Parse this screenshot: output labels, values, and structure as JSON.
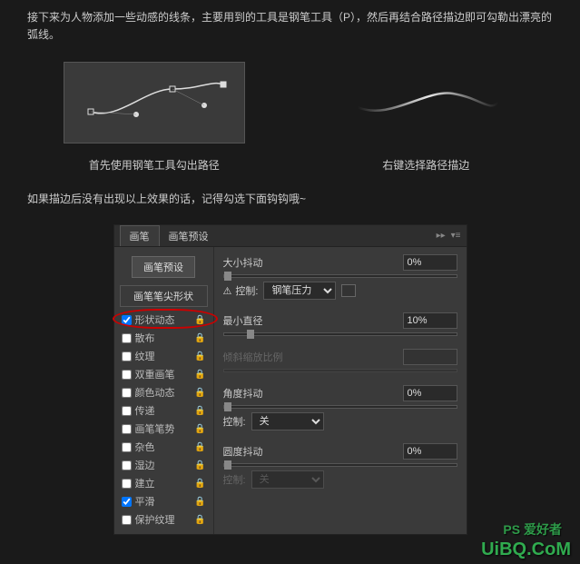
{
  "intro": "接下来为人物添加一些动感的线条，主要用到的工具是钢笔工具（P），然后再结合路径描边即可勾勒出漂亮的弧线。",
  "demo1_caption": "首先使用钢笔工具勾出路径",
  "demo2_caption": "右键选择路径描边",
  "note": "如果描边后没有出现以上效果的话，记得勾选下面钩钩哦~",
  "panel": {
    "tab_brush": "画笔",
    "tab_preset": "画笔预设",
    "preset_btn": "画笔预设",
    "tip_btn": "画笔笔尖形状",
    "options": [
      {
        "label": "形状动态",
        "checked": true,
        "locked": true,
        "highlight": true
      },
      {
        "label": "散布",
        "checked": false,
        "locked": true
      },
      {
        "label": "纹理",
        "checked": false,
        "locked": true
      },
      {
        "label": "双重画笔",
        "checked": false,
        "locked": true
      },
      {
        "label": "颜色动态",
        "checked": false,
        "locked": true
      },
      {
        "label": "传递",
        "checked": false,
        "locked": true
      },
      {
        "label": "画笔笔势",
        "checked": false,
        "locked": true
      },
      {
        "label": "杂色",
        "checked": false,
        "locked": true
      },
      {
        "label": "湿边",
        "checked": false,
        "locked": true
      },
      {
        "label": "建立",
        "checked": false,
        "locked": true
      },
      {
        "label": "平滑",
        "checked": true,
        "locked": true
      },
      {
        "label": "保护纹理",
        "checked": false,
        "locked": true
      }
    ],
    "controls": {
      "size_jitter_label": "大小抖动",
      "size_jitter_value": "0%",
      "control_label": "控制:",
      "control_value": "钢笔压力",
      "min_diameter_label": "最小直径",
      "min_diameter_value": "10%",
      "tilt_scale_label": "倾斜缩放比例",
      "angle_jitter_label": "角度抖动",
      "angle_jitter_value": "0%",
      "control2_label": "控制:",
      "control2_value": "关",
      "roundness_jitter_label": "圆度抖动",
      "roundness_jitter_value": "0%",
      "control3_label": "控制:",
      "control3_value": "关"
    }
  },
  "watermark2": "PS 爱好者",
  "watermark": "UiBQ.CoM"
}
